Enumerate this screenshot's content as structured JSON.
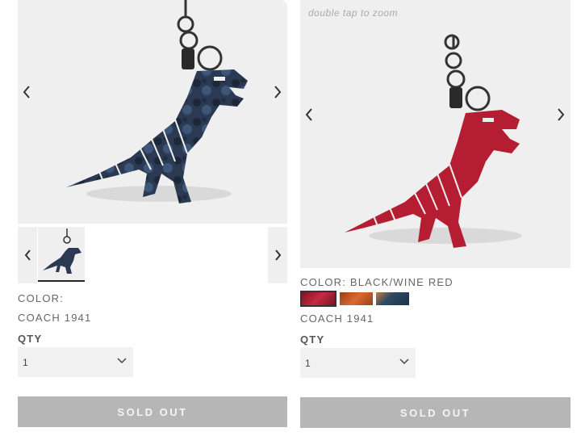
{
  "left": {
    "color_label": "COLOR:",
    "brand": "COACH 1941",
    "qty_label": "QTY",
    "qty_value": "1",
    "button_label": "SOLD OUT"
  },
  "right": {
    "zoom_hint": "double tap to zoom",
    "color_label": "COLOR: BLACK/WINE RED",
    "brand": "COACH 1941",
    "qty_label": "QTY",
    "qty_value": "1",
    "button_label": "SOLD OUT",
    "swatches": [
      {
        "name": "black/wine red",
        "color": "#b0203a",
        "selected": true
      },
      {
        "name": "black/orange",
        "color": "#c95a2a",
        "selected": false
      },
      {
        "name": "black/blue camo",
        "color": "#2e4a66",
        "selected": false
      }
    ]
  },
  "colors": {
    "hero_bg": "#efefef",
    "sold_out_bg": "#b6b6b6",
    "camo_blue": "#2e3e58",
    "wine_red": "#b51d32"
  },
  "icons": {
    "prev": "chevron-left-icon",
    "next": "chevron-right-icon",
    "dropdown": "chevron-down-icon"
  }
}
